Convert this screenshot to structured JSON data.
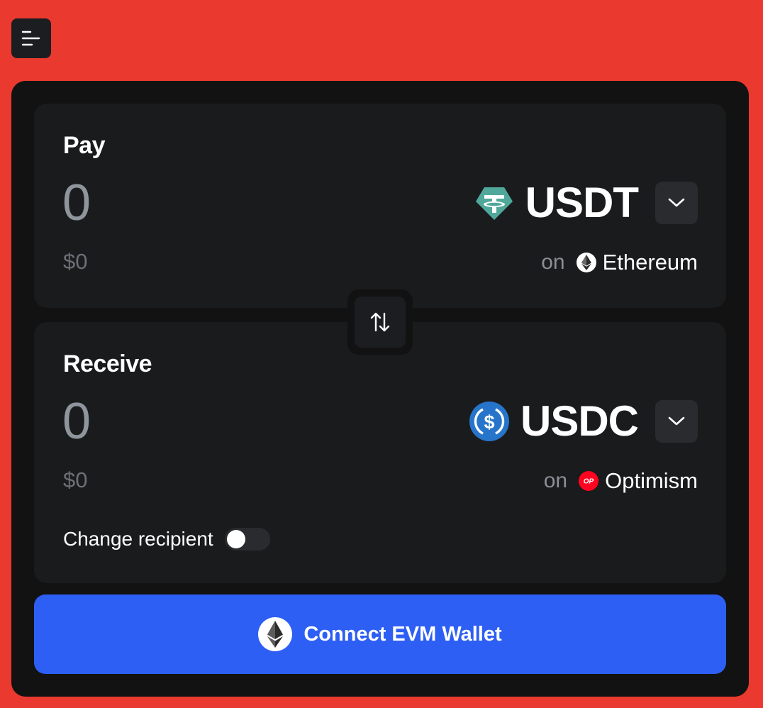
{
  "menu": {
    "icon": "menu-icon"
  },
  "pay": {
    "title": "Pay",
    "amount": "0",
    "usd_value": "$0",
    "token": {
      "symbol": "USDT",
      "icon": "usdt-icon",
      "color": "#4fa89a"
    },
    "chain": {
      "prefix": "on",
      "name": "Ethereum",
      "icon": "ethereum-icon"
    }
  },
  "swap": {
    "icon": "swap-arrows-icon"
  },
  "receive": {
    "title": "Receive",
    "amount": "0",
    "usd_value": "$0",
    "token": {
      "symbol": "USDC",
      "icon": "usdc-icon",
      "color": "#2775ca"
    },
    "chain": {
      "prefix": "on",
      "name": "Optimism",
      "icon": "optimism-icon",
      "badge": "OP",
      "color": "#ff0420"
    },
    "change_recipient": {
      "label": "Change recipient",
      "enabled": false
    }
  },
  "connect": {
    "label": "Connect EVM Wallet",
    "icon": "ethereum-icon"
  },
  "colors": {
    "background": "#ea3a2f",
    "card": "#121212",
    "panel": "#1a1b1d",
    "primary_button": "#2d5ff5"
  }
}
